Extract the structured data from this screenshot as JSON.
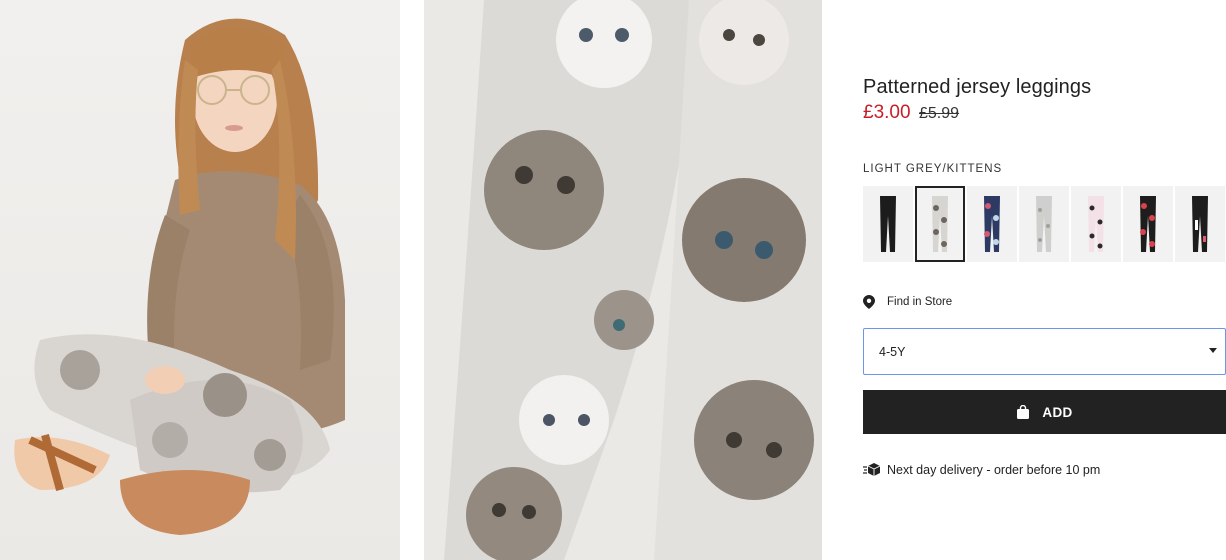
{
  "product": {
    "title": "Patterned jersey leggings",
    "price_sale": "£3.00",
    "price_original": "£5.99"
  },
  "colors": {
    "selected_label": "LIGHT GREY/KITTENS",
    "swatches": [
      {
        "name": "black"
      },
      {
        "name": "light grey/kittens",
        "selected": true
      },
      {
        "name": "navy/floral"
      },
      {
        "name": "light grey/pattern"
      },
      {
        "name": "light pink/bows"
      },
      {
        "name": "black/roses"
      },
      {
        "name": "black/pattern"
      }
    ]
  },
  "store": {
    "find_label": "Find in Store"
  },
  "size": {
    "selected": "4-5Y"
  },
  "cart": {
    "add_label": "ADD"
  },
  "delivery": {
    "text": "Next day delivery - order before 10 pm"
  },
  "icons": {
    "store": "map-pin-icon",
    "bag": "shopping-bag-icon",
    "delivery": "delivery-truck-icon",
    "dropdown": "caret-down-icon"
  },
  "theme": {
    "sale_color": "#c81e29",
    "button_bg": "#222222",
    "focus_border": "#6f95e8"
  }
}
